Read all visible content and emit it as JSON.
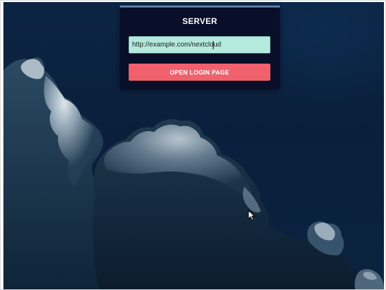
{
  "panel": {
    "title": "SERVER",
    "server_input": {
      "value": "http://example.com/nextcloud",
      "placeholder": ""
    },
    "login_button_label": "OPEN LOGIN PAGE"
  },
  "icons": {
    "cursor": "mouse-pointer-icon"
  },
  "colors": {
    "panel_background": "#0a0f29",
    "panel_accent": "#5f7fa5",
    "input_background": "#b4e9dd",
    "button_background": "#f0606d",
    "sky_background": "#0a1f3b"
  }
}
